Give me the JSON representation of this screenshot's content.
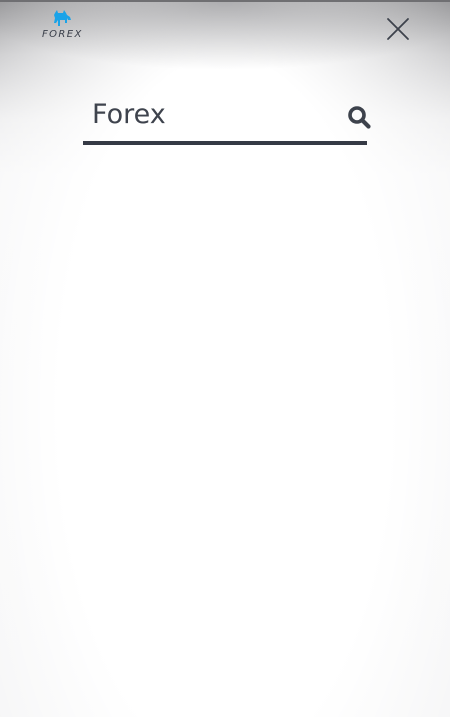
{
  "brand": {
    "logo_text": "FOREX",
    "logo_icon": "bull-icon",
    "accent_color": "#1aa3e8"
  },
  "header": {
    "close_icon": "close-icon"
  },
  "search": {
    "value": "Forex",
    "icon": "search-icon"
  },
  "colors": {
    "text": "#3e434d",
    "underline": "#353a45"
  }
}
